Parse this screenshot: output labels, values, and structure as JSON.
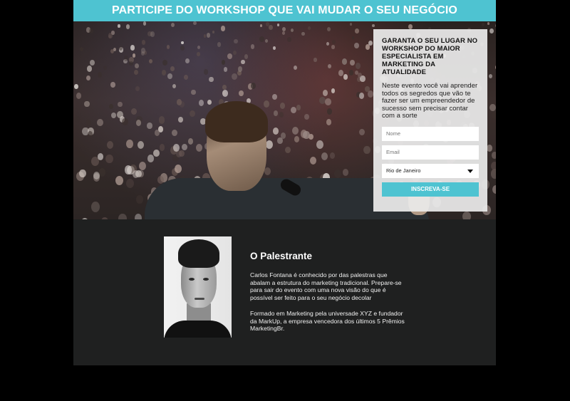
{
  "banner": {
    "title": "PARTICIPE DO WORKSHOP QUE VAI MUDAR O SEU NEGÓCIO"
  },
  "form": {
    "title": "GARANTA O SEU LUGAR NO WORKSHOP DO MAIOR ESPECIALISTA EM MARKETING DA ATUALIDADE",
    "description": "Neste evento você vai aprender todos os segredos que vão te fazer ser um empreendedor de sucesso sem precisar contar com a sorte",
    "name_placeholder": "Nome",
    "email_placeholder": "Email",
    "city_selected": "Rio de Janeiro",
    "submit_label": "INSCREVA-SE"
  },
  "speaker": {
    "heading": "O Palestrante",
    "bio_1": "Carlos Fontana é conhecido por das palestras que abalam a estrutura do marketing tradicional. Prepare-se para sair do evento com uma nova visão do que é possível ser feito para o seu negócio decolar",
    "bio_2": "Formado em Marketing pela universade XYZ e fundador da MarkUp, a empresa vencedora dos últimos 5 Prêmios MarketingBr."
  },
  "colors": {
    "accent": "#4ec3d1",
    "background": "#1f2020"
  },
  "icons": {
    "select_caret": "chevron-down-icon"
  }
}
